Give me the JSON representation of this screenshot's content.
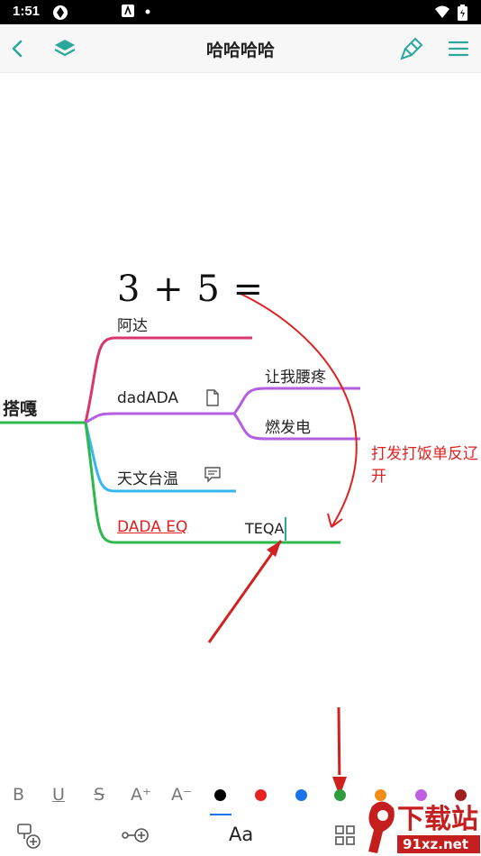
{
  "status": {
    "time": "1:51"
  },
  "appbar": {
    "title": "哈哈哈哈"
  },
  "mindmap": {
    "root": "搭嘎",
    "formula": "3 + 5 =",
    "branches": {
      "b1": "阿达",
      "b2": "dadADA",
      "b2_sub1": "让我腰疼",
      "b2_sub2": "燃发电",
      "b3": "天文台温",
      "b4": "DADA EQ",
      "b4_sub": "TEQA"
    },
    "annotation": "打发打饭单反辽开"
  },
  "toolbar": {
    "bold": "B",
    "underline": "U",
    "strike": "S",
    "font_up": "A⁺",
    "font_down": "A⁻",
    "text_style": "Aa",
    "colors": [
      "#000000",
      "#e82020",
      "#1a73e8",
      "#2e9c3a",
      "#f08c1a",
      "#c060e0",
      "#a02020"
    ]
  },
  "watermark": {
    "text": "下载站",
    "sub": "91xz.net"
  }
}
